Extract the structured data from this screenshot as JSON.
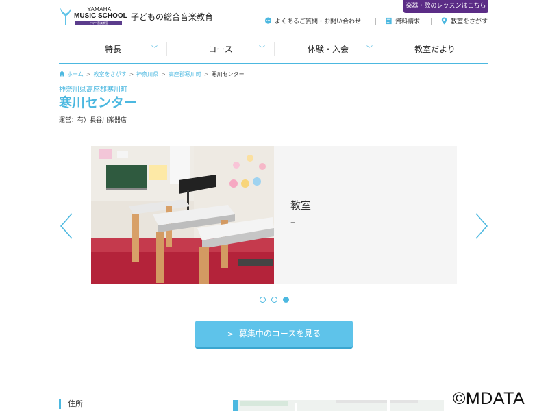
{
  "header": {
    "logo_line1": "YAMAHA",
    "logo_line2": "MUSIC SCHOOL",
    "logo_bar_text": "ヤマハ音楽教室",
    "tagline": "子どもの総合音楽教育",
    "lesson_button": "楽器・歌のレッスンはこちら",
    "utility": [
      {
        "label": "よくあるご質問・お問い合わせ",
        "icon": "chat-bubble-icon"
      },
      {
        "label": "資料請求",
        "icon": "document-icon"
      },
      {
        "label": "教室をさがす",
        "icon": "map-pin-icon"
      }
    ]
  },
  "nav": [
    {
      "label": "特長",
      "has_dropdown": true
    },
    {
      "label": "コース",
      "has_dropdown": true
    },
    {
      "label": "体験・入会",
      "has_dropdown": true
    },
    {
      "label": "教室だより",
      "has_dropdown": false
    }
  ],
  "breadcrumb": [
    "ホーム",
    "教室をさがす",
    "神奈川県",
    "高座郡寒川町",
    "寒川センター"
  ],
  "region": "神奈川県高座郡寒川町",
  "title": "寒川センター",
  "operator": "運営：有）長谷川楽器店",
  "slider": {
    "label": "教室",
    "sub": "–",
    "dot_count": 3,
    "active_dot": 2
  },
  "cta_label": "募集中のコースを見る",
  "bottom": {
    "address_label": "住所"
  },
  "watermark": "©MDATA",
  "colors": {
    "accent": "#4cb8e0",
    "purple": "#5b2c86",
    "cta": "#5ec3ea"
  }
}
